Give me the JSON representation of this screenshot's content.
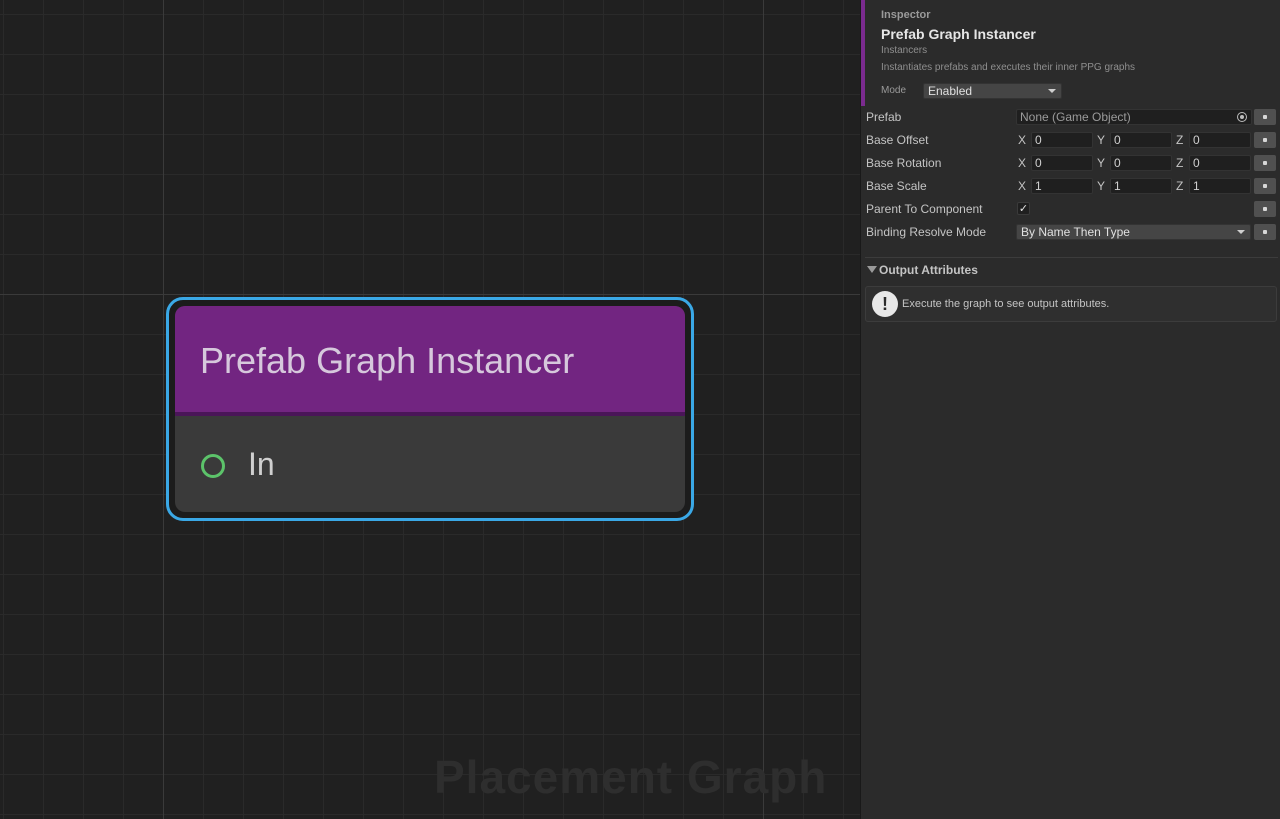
{
  "canvas": {
    "watermark": "Placement Graph",
    "node": {
      "title": "Prefab Graph Instancer",
      "input_port": "In"
    }
  },
  "inspector": {
    "caption": "Inspector",
    "title": "Prefab Graph Instancer",
    "category": "Instancers",
    "description": "Instantiates prefabs and executes their inner PPG graphs",
    "mode_label": "Mode",
    "mode_value": "Enabled",
    "rows": {
      "prefab": {
        "label": "Prefab",
        "value": "None (Game Object)"
      },
      "base_offset": {
        "label": "Base Offset",
        "x": "0",
        "y": "0",
        "z": "0"
      },
      "base_rotation": {
        "label": "Base Rotation",
        "x": "0",
        "y": "0",
        "z": "0"
      },
      "base_scale": {
        "label": "Base Scale",
        "x": "1",
        "y": "1",
        "z": "1"
      },
      "parent_to_component": {
        "label": "Parent To Component",
        "checked": true,
        "check_glyph": "✓"
      },
      "binding_resolve_mode": {
        "label": "Binding Resolve Mode",
        "value": "By Name Then Type"
      }
    },
    "axes": {
      "x": "X",
      "y": "Y",
      "z": "Z"
    },
    "output_attributes": {
      "title": "Output Attributes",
      "icon_glyph": "!",
      "message": "Execute the graph to see output attributes."
    }
  },
  "colors": {
    "canvas_bg": "#202020",
    "node_header": "#722581",
    "node_selection": "#3aa8e6",
    "port_green": "#5cc36a",
    "inspector_accent": "#7b2b8f"
  }
}
